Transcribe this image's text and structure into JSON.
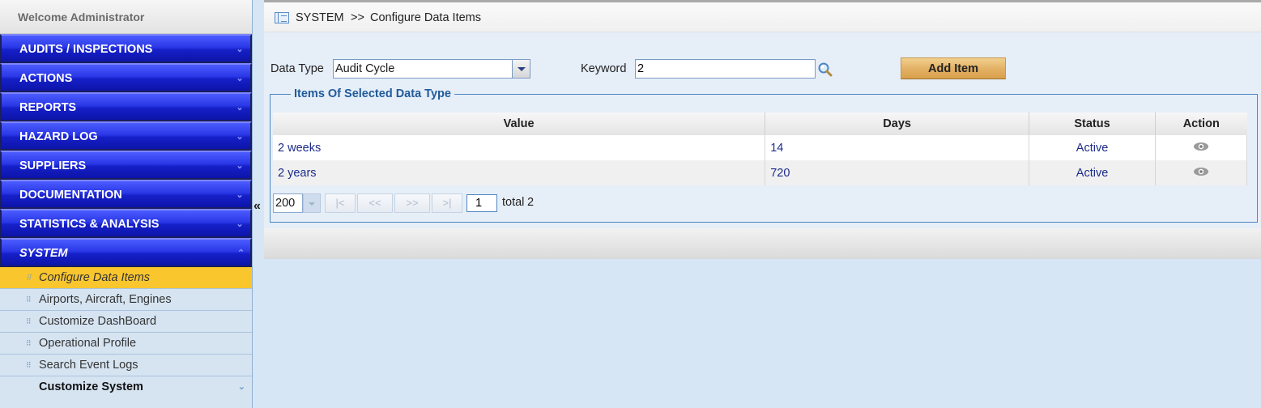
{
  "sidebar": {
    "welcome": "Welcome  Administrator",
    "menus": [
      {
        "label": "AUDITS / INSPECTIONS"
      },
      {
        "label": "ACTIONS"
      },
      {
        "label": "REPORTS"
      },
      {
        "label": "HAZARD LOG"
      },
      {
        "label": "SUPPLIERS"
      },
      {
        "label": "DOCUMENTATION"
      },
      {
        "label": "STATISTICS & ANALYSIS"
      },
      {
        "label": "SYSTEM"
      }
    ],
    "system_items": [
      {
        "label": "Configure Data Items"
      },
      {
        "label": "Airports, Aircraft, Engines"
      },
      {
        "label": "Customize DashBoard"
      },
      {
        "label": "Operational Profile"
      },
      {
        "label": "Search Event Logs"
      },
      {
        "label": "Customize System"
      }
    ],
    "collapse_glyph": "«"
  },
  "breadcrumb": {
    "section": "SYSTEM",
    "separator": ">>",
    "page": "Configure Data Items"
  },
  "filters": {
    "data_type_label": "Data Type",
    "data_type_value": "Audit Cycle",
    "keyword_label": "Keyword",
    "keyword_value": "2",
    "add_button": "Add Item"
  },
  "grid": {
    "legend": "Items Of Selected Data Type",
    "columns": [
      "Value",
      "Days",
      "Status",
      "Action"
    ],
    "rows": [
      {
        "value": "2 weeks",
        "days": "14",
        "status": "Active"
      },
      {
        "value": "2 years",
        "days": "720",
        "status": "Active"
      }
    ],
    "pager": {
      "page_size": "200",
      "first": "|<",
      "prev": "<<",
      "next": ">>",
      "last": ">|",
      "page": "1",
      "total_label": "total",
      "total": "2"
    }
  },
  "colors": {
    "menu_blue": "#2a37e6",
    "active_item": "#f9c62e",
    "button_gold": "#e3b266",
    "link_blue": "#1d2c8c",
    "legend_blue": "#1f5a9a"
  }
}
